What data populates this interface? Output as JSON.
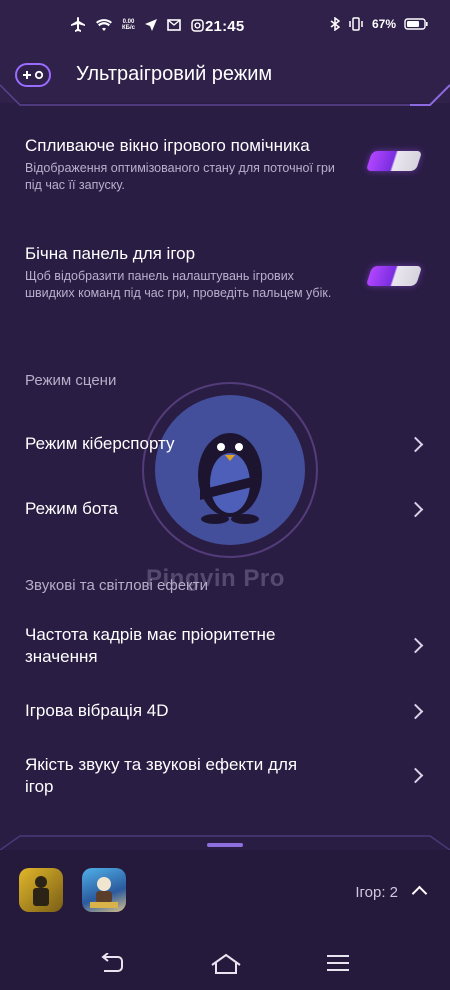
{
  "status_bar": {
    "time": "21:45",
    "network_speed": "0.00",
    "network_unit": "КБ/с",
    "battery_percent": "67%"
  },
  "header": {
    "title": "Ультраігровий режим",
    "icon": "gamepad-icon"
  },
  "settings": [
    {
      "label": "Спливаюче вікно ігрового помічника",
      "description": "Відображення оптимізованого стану для поточної гри під час її запуску.",
      "enabled": true
    },
    {
      "label": "Бічна панель для ігор",
      "description": "Щоб відобразити панель налаштувань ігрових швидких команд під час гри, проведіть пальцем убік.",
      "enabled": true
    }
  ],
  "sections": {
    "scene_mode": "Режим сцени",
    "sound_light": "Звукові та світлові ефекти"
  },
  "nav_items": [
    {
      "label": "Режим кіберспорту"
    },
    {
      "label": "Режим бота"
    },
    {
      "label": "Частота кадрів має пріоритетне значення"
    },
    {
      "label": "Ігрова вібрація 4D"
    },
    {
      "label": "Якість звуку та звукові ефекти для ігор"
    }
  ],
  "watermark": {
    "text": "Pingvin Pro"
  },
  "dock": {
    "games_count": "Ігор: 2",
    "apps": [
      "game-app-icon-1",
      "pubg-app-icon"
    ]
  },
  "colors": {
    "background": "#2a1d44",
    "accent": "#9a5cff"
  }
}
